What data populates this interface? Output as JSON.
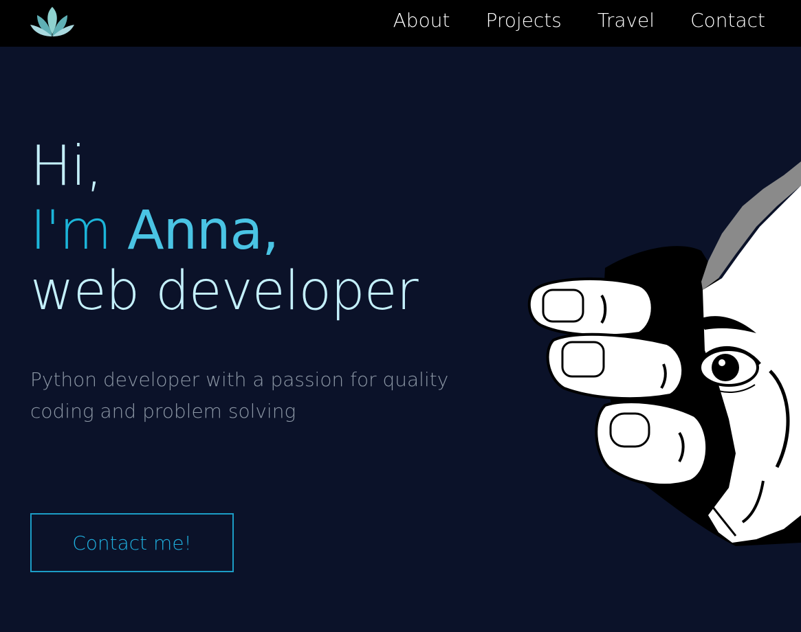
{
  "nav": {
    "items": [
      {
        "label": "About"
      },
      {
        "label": "Projects"
      },
      {
        "label": "Travel"
      },
      {
        "label": "Contact"
      }
    ]
  },
  "hero": {
    "greeting": "Hi,",
    "intro_prefix": "I'm ",
    "name": "Anna,",
    "role": "web developer",
    "tagline": "Python developer with a passion for quality coding and problem solving",
    "cta_label": "Contact me!"
  },
  "colors": {
    "page_background": "#0b1229",
    "topbar_background": "#000000",
    "accent": "#1cb5d9",
    "heading_light": "#c4f0fb",
    "tagline_text": "#8d98a6",
    "button_border": "#1c9dc6"
  },
  "icons": {
    "logo": "lotus-icon",
    "hero_art": "hand-peeking-eye-illustration"
  }
}
